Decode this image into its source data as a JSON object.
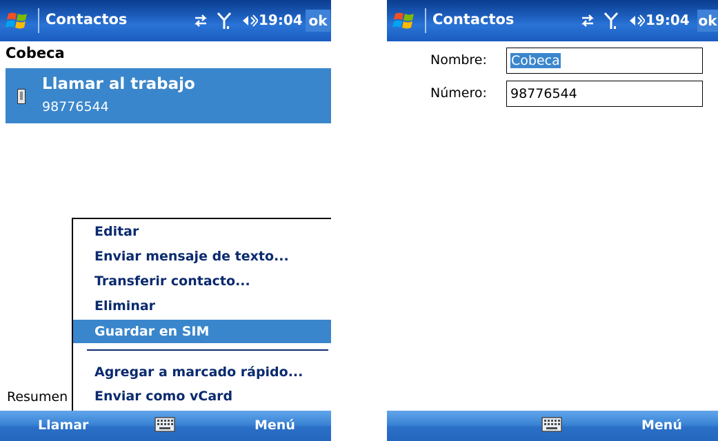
{
  "status": {
    "title": "Contactos",
    "time": "19:04",
    "ok_label": "ok",
    "icons": [
      "windows-flag-icon",
      "connectivity-arrows-icon",
      "signal-antenna-icon",
      "speaker-volume-icon",
      "keyboard-icon",
      "phone-icon"
    ]
  },
  "left": {
    "contact_name": "Cobeca",
    "call": {
      "label": "Llamar al trabajo",
      "number": "98776544"
    },
    "menu": {
      "items": [
        "Editar",
        "Enviar mensaje de texto...",
        "Transferir contacto...",
        "Eliminar",
        "Guardar en SIM",
        "Agregar a marcado rápido...",
        "Enviar como vCard"
      ],
      "selected": "Guardar en SIM"
    },
    "tab_label": "Resumen",
    "softkeys": {
      "left": "Llamar",
      "right": "Menú"
    }
  },
  "right": {
    "name_label": "Nombre:",
    "name_value": "Cobeca",
    "number_label": "Número:",
    "number_value": "98776544",
    "softkeys": {
      "left": "",
      "right": "Menú"
    }
  },
  "colors": {
    "titlebar": "#1f63c4",
    "highlight": "#3a86cc",
    "menu_text": "#0a2a6e"
  }
}
